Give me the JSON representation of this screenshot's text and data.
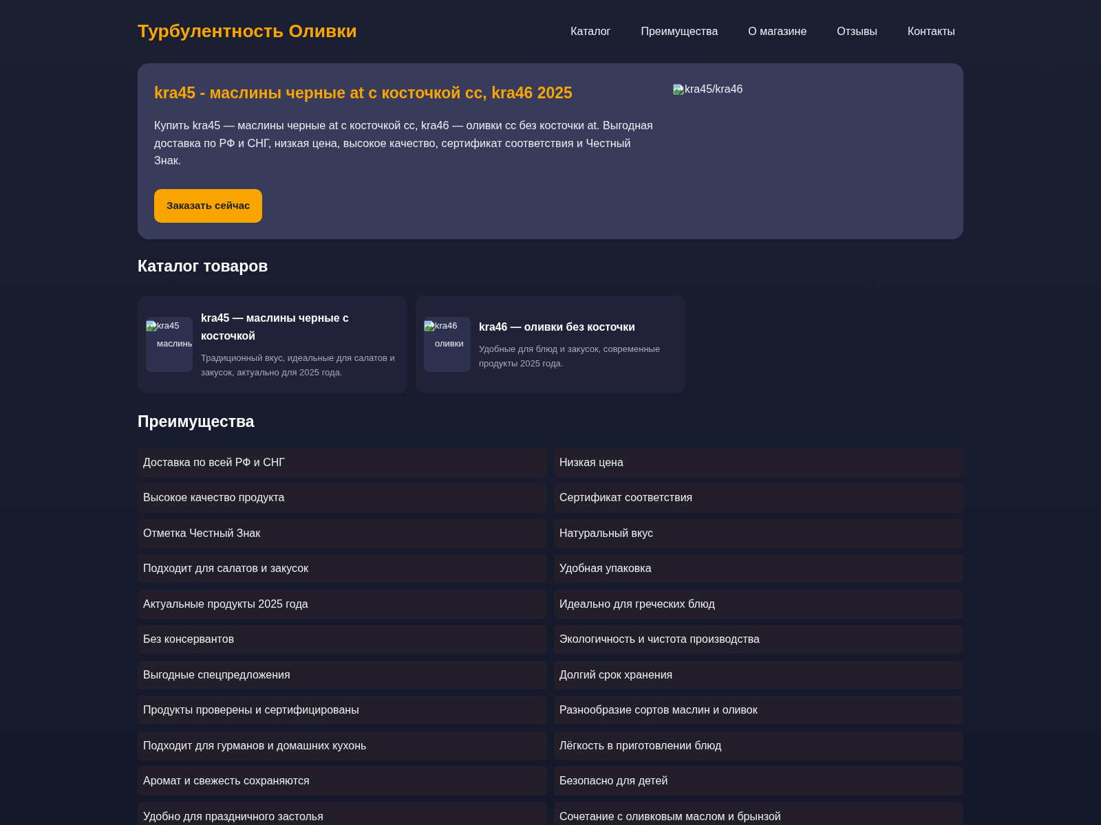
{
  "header": {
    "logo": "Турбулентность Оливки",
    "nav": [
      "Каталог",
      "Преимущества",
      "О магазине",
      "Отзывы",
      "Контакты"
    ]
  },
  "hero": {
    "title": "kra45 - маслины черные at с косточкой cc, kra46 2025",
    "text": "Купить kra45 — маслины черные at с косточкой cc, kra46 — оливки cc без косточки at. Выгодная доставка по РФ и СНГ, низкая цена, высокое качество, сертификат соответствия и Честный Знак.",
    "button": "Заказать сейчас",
    "image_alt": "kra45/kra46"
  },
  "catalog": {
    "heading": "Каталог товаров",
    "products": [
      {
        "image_alt": "kra45 маслины",
        "title": "kra45 — маслины черные с косточкой",
        "description": "Традиционный вкус, идеальные для салатов и закусок, актуально для 2025 года."
      },
      {
        "image_alt": "kra46 оливки",
        "title": "kra46 — оливки без косточки",
        "description": "Удобные для блюд и закусок, современные продукты 2025 года."
      }
    ]
  },
  "advantages": {
    "heading": "Преимущества",
    "items": [
      "Доставка по всей РФ и СНГ",
      "Низкая цена",
      "Высокое качество продукта",
      "Сертификат соответствия",
      "Отметка Честный Знак",
      "Натуральный вкус",
      "Подходит для салатов и закусок",
      "Удобная упаковка",
      "Актуальные продукты 2025 года",
      "Идеально для греческих блюд",
      "Без консервантов",
      "Экологичность и чистота производства",
      "Выгодные спецпредложения",
      "Долгий срок хранения",
      "Продукты проверены и сертифицированы",
      "Разнообразие сортов маслин и оливок",
      "Подходит для гурманов и домашних кухонь",
      "Лёгкость в приготовлении блюд",
      "Аромат и свежесть сохраняются",
      "Безопасно для детей",
      "Удобно для праздничного застолья",
      "Сочетание с оливковым маслом и брынзой"
    ]
  }
}
